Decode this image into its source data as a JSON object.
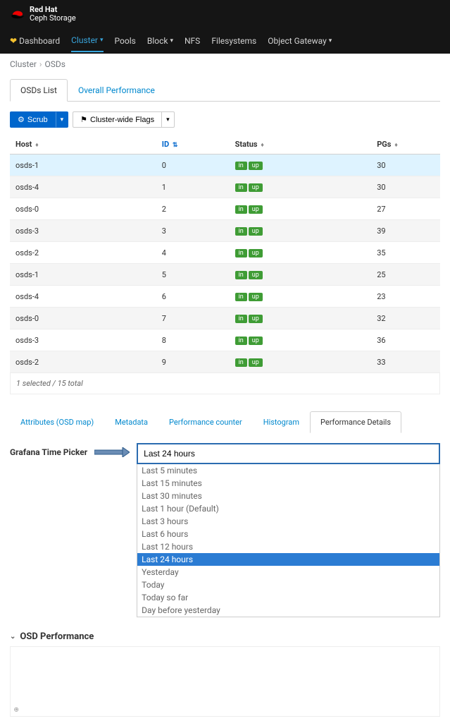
{
  "header": {
    "brand": "Red Hat",
    "product": "Ceph Storage"
  },
  "nav": {
    "dashboard": "Dashboard",
    "cluster": "Cluster",
    "pools": "Pools",
    "block": "Block",
    "nfs": "NFS",
    "filesystems": "Filesystems",
    "gateway": "Object Gateway"
  },
  "breadcrumb": {
    "a": "Cluster",
    "b": "OSDs"
  },
  "main_tabs": {
    "list": "OSDs List",
    "perf": "Overall Performance"
  },
  "toolbar": {
    "scrub": "Scrub",
    "flags": "Cluster-wide Flags"
  },
  "columns": {
    "host": "Host",
    "id": "ID",
    "status": "Status",
    "pgs": "PGs"
  },
  "rows": [
    {
      "host": "osds-1",
      "id": "0",
      "in": "in",
      "up": "up",
      "pgs": "30"
    },
    {
      "host": "osds-4",
      "id": "1",
      "in": "in",
      "up": "up",
      "pgs": "30"
    },
    {
      "host": "osds-0",
      "id": "2",
      "in": "in",
      "up": "up",
      "pgs": "27"
    },
    {
      "host": "osds-3",
      "id": "3",
      "in": "in",
      "up": "up",
      "pgs": "39"
    },
    {
      "host": "osds-2",
      "id": "4",
      "in": "in",
      "up": "up",
      "pgs": "35"
    },
    {
      "host": "osds-1",
      "id": "5",
      "in": "in",
      "up": "up",
      "pgs": "25"
    },
    {
      "host": "osds-4",
      "id": "6",
      "in": "in",
      "up": "up",
      "pgs": "23"
    },
    {
      "host": "osds-0",
      "id": "7",
      "in": "in",
      "up": "up",
      "pgs": "32"
    },
    {
      "host": "osds-3",
      "id": "8",
      "in": "in",
      "up": "up",
      "pgs": "36"
    },
    {
      "host": "osds-2",
      "id": "9",
      "in": "in",
      "up": "up",
      "pgs": "33"
    }
  ],
  "footer": "1 selected / 15 total",
  "detail_tabs": {
    "attrs": "Attributes (OSD map)",
    "meta": "Metadata",
    "perfc": "Performance counter",
    "hist": "Histogram",
    "perfd": "Performance Details"
  },
  "time_picker": {
    "label": "Grafana Time Picker",
    "value": "Last 24 hours",
    "options": [
      "Last 5 minutes",
      "Last 15 minutes",
      "Last 30 minutes",
      "Last 1 hour (Default)",
      "Last 3 hours",
      "Last 6 hours",
      "Last 12 hours",
      "Last 24 hours",
      "Yesterday",
      "Today",
      "Today so far",
      "Day before yesterday"
    ],
    "selected_index": 7
  },
  "perf_panel": {
    "title": "OSD Performance"
  }
}
